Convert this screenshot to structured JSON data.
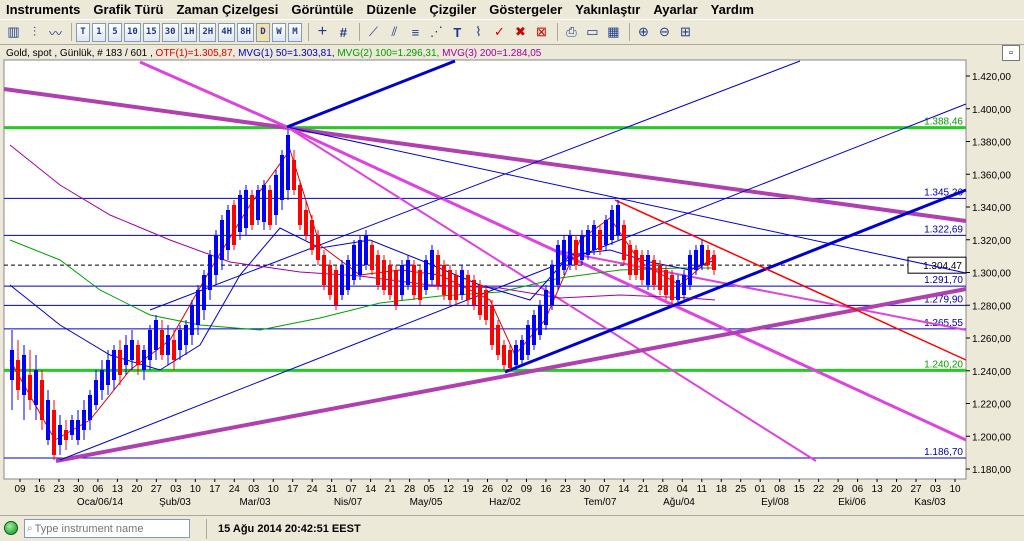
{
  "menu": [
    "Instruments",
    "Grafik Türü",
    "Zaman Çizelgesi",
    "Görüntüle",
    "Düzenle",
    "Çizgiler",
    "Göstergeler",
    "Yakınlaştır",
    "Ayarlar",
    "Yardım"
  ],
  "toolbar": {
    "timeframes": [
      "T",
      "1",
      "5",
      "10",
      "15",
      "30",
      "1H",
      "2H",
      "4H",
      "8H",
      "D",
      "W",
      "M"
    ],
    "active_timeframe": "D"
  },
  "chart": {
    "title_parts": [
      {
        "text": "Gold, spot , Günlük, # 183 / 601 ,",
        "color": "#000000"
      },
      {
        "text": "OTF(1)=1.305,87,",
        "color": "#e00000"
      },
      {
        "text": "MVG(1) 50=1.303,81,",
        "color": "#0000c8"
      },
      {
        "text": "MVG(2) 100=1.296,31,",
        "color": "#00a000"
      },
      {
        "text": "MVG(3) 200=1.284,05",
        "color": "#a000a0"
      }
    ],
    "price_labels": [
      "1.420,00",
      "1.400,00",
      "1.380,00",
      "1.360,00",
      "1.340,00",
      "1.320,00",
      "1.300,00",
      "1.280,00",
      "1.260,00",
      "1.240,00",
      "1.220,00",
      "1.200,00",
      "1.180,00"
    ],
    "level_labels": [
      {
        "text": "1.388,46",
        "price": 1388.46,
        "color": "#00a000"
      },
      {
        "text": "1.345,26",
        "price": 1345.26,
        "color": "#0000a0"
      },
      {
        "text": "1.322,69",
        "price": 1322.69,
        "color": "#0000a0"
      },
      {
        "text": "1.291,70",
        "price": 1291.7,
        "color": "#0000a0"
      },
      {
        "text": "1.279,90",
        "price": 1279.9,
        "color": "#0000a0"
      },
      {
        "text": "1.265,55",
        "price": 1265.55,
        "color": "#0000a0"
      },
      {
        "text": "1.240,20",
        "price": 1240.2,
        "color": "#00a000"
      },
      {
        "text": "1.186,70",
        "price": 1186.7,
        "color": "#0000a0"
      }
    ],
    "current_price": "1.304,47",
    "day_labels": [
      "09",
      "16",
      "23",
      "30",
      "06",
      "13",
      "20",
      "27",
      "03",
      "10",
      "17",
      "24",
      "03",
      "10",
      "17",
      "24",
      "31",
      "07",
      "14",
      "21",
      "28",
      "05",
      "12",
      "19",
      "26",
      "02",
      "09",
      "16",
      "23",
      "30",
      "07",
      "14",
      "21",
      "28",
      "04",
      "11",
      "18",
      "25",
      "01",
      "08",
      "15",
      "22",
      "29",
      "06",
      "13",
      "20",
      "27",
      "03",
      "10"
    ],
    "month_labels": [
      "Oca/06/14",
      "Şub/03",
      "Mar/03",
      "Nis/07",
      "May/05",
      "Haz/02",
      "Tem/07",
      "Ağu/04",
      "Eyl/08",
      "Eki/06",
      "Kas/03"
    ],
    "colors": {
      "green": "#22cc22",
      "magenta": "#dd44dd",
      "purple": "#b040b0",
      "blue": "#0000cc",
      "red": "#ff0000"
    }
  },
  "status": {
    "search_placeholder": "Type instrument name",
    "datetime": "15 Ağu 2014 20:42:51 EEST"
  }
}
